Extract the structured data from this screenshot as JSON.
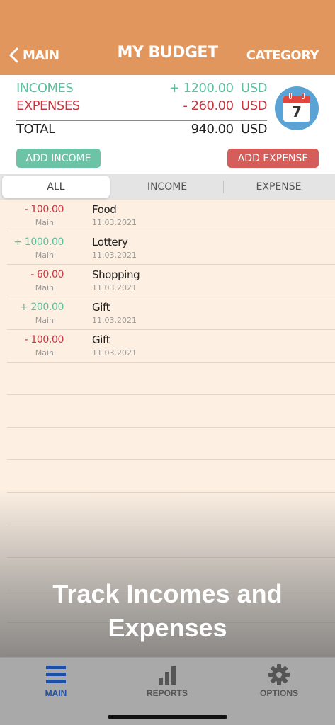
{
  "header": {
    "back_label": "MAIN",
    "title": "MY BUDGET",
    "category_label": "CATEGORY"
  },
  "summary": {
    "incomes_label": "INCOMES",
    "incomes_amount": "+ 1200.00",
    "incomes_currency": "USD",
    "expenses_label": "EXPENSES",
    "expenses_amount": "- 260.00",
    "expenses_currency": "USD",
    "total_label": "TOTAL",
    "total_amount": "940.00",
    "total_currency": "USD",
    "calendar_day": "7"
  },
  "actions": {
    "add_income": "ADD INCOME",
    "add_expense": "ADD EXPENSE"
  },
  "filter_tabs": {
    "all": "ALL",
    "income": "INCOME",
    "expense": "EXPENSE",
    "selected": "ALL"
  },
  "transactions": [
    {
      "amount": "- 100.00",
      "type": "expense",
      "account": "Main",
      "name": "Food",
      "date": "11.03.2021"
    },
    {
      "amount": "+ 1000.00",
      "type": "income",
      "account": "Main",
      "name": "Lottery",
      "date": "11.03.2021"
    },
    {
      "amount": "- 60.00",
      "type": "expense",
      "account": "Main",
      "name": "Shopping",
      "date": "11.03.2021"
    },
    {
      "amount": "+ 200.00",
      "type": "income",
      "account": "Main",
      "name": "Gift",
      "date": "11.03.2021"
    },
    {
      "amount": "- 100.00",
      "type": "expense",
      "account": "Main",
      "name": "Gift",
      "date": "11.03.2021"
    }
  ],
  "promo": {
    "line1": "Track Incomes and",
    "line2": "Expenses"
  },
  "tabbar": {
    "main": "MAIN",
    "reports": "REPORTS",
    "options": "OPTIONS",
    "active": "MAIN"
  },
  "colors": {
    "header": "#e1965e",
    "income_green": "#5cbf9e",
    "expense_red": "#c8353f",
    "list_background": "#fdf0e3",
    "tab_active_blue": "#1f4fa3"
  },
  "icons": {
    "back": "chevron-left-icon",
    "calendar": "calendar-icon",
    "main_tab": "menu-lines-icon",
    "reports_tab": "bar-chart-icon",
    "options_tab": "gear-icon"
  }
}
